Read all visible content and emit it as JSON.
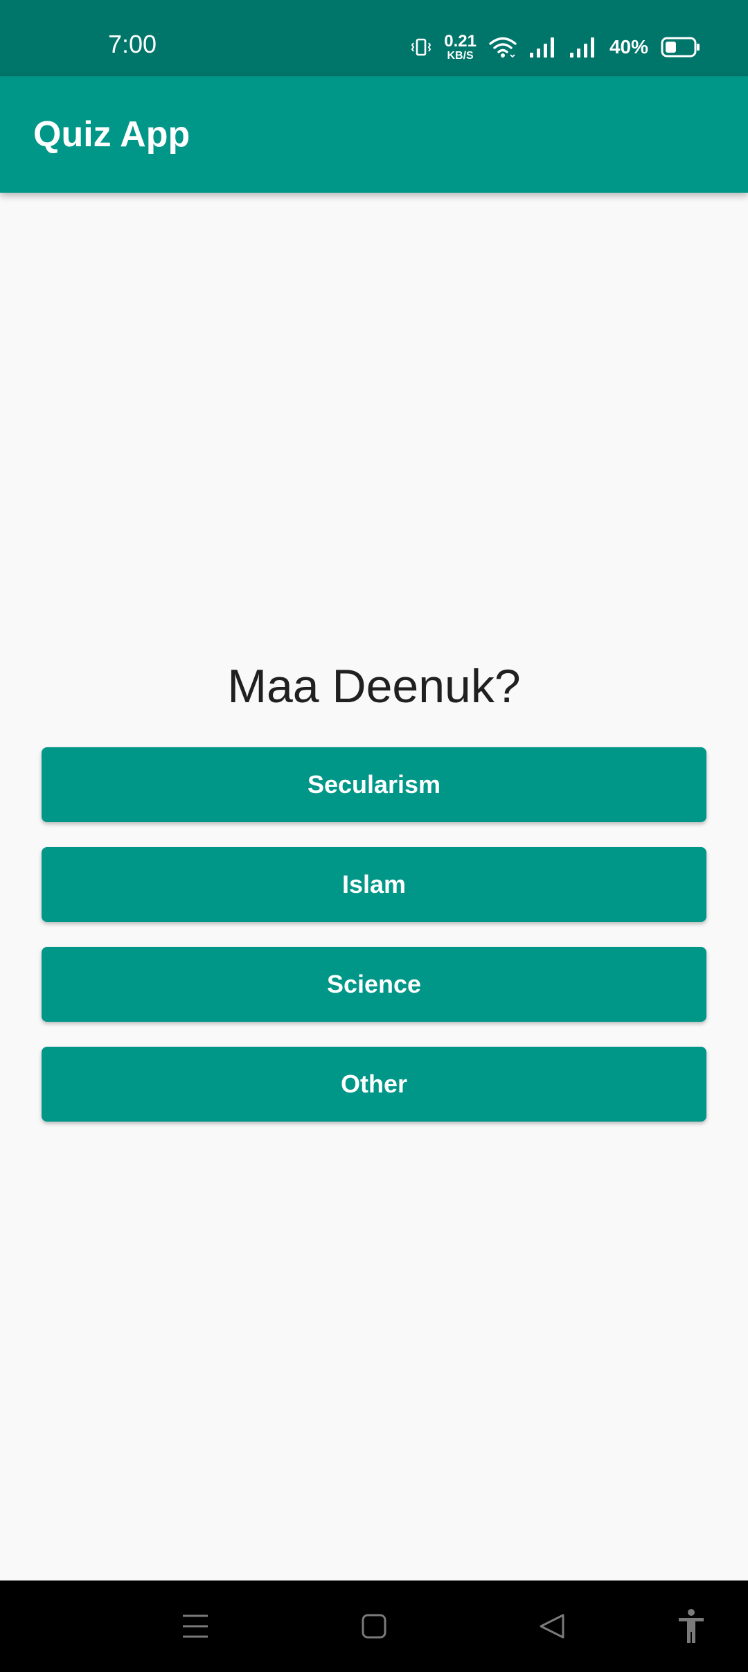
{
  "status_bar": {
    "time": "7:00",
    "net_speed_value": "0.21",
    "net_speed_unit": "KB/S",
    "battery_percent": "40%",
    "battery_level": 0.4,
    "icons": [
      "vibrate-icon",
      "wifi-icon",
      "signal-icon",
      "signal-icon",
      "battery-icon"
    ],
    "background": "#00756a"
  },
  "app_bar": {
    "title": "Quiz App",
    "background": "#009688"
  },
  "quiz": {
    "question": "Maa Deenuk?",
    "answers": [
      {
        "label": "Secularism"
      },
      {
        "label": "Islam"
      },
      {
        "label": "Science"
      },
      {
        "label": "Other"
      }
    ],
    "button_color": "#009688"
  },
  "nav_bar": {
    "icons": [
      "menu-icon",
      "home-icon",
      "back-icon",
      "accessibility-icon"
    ]
  }
}
